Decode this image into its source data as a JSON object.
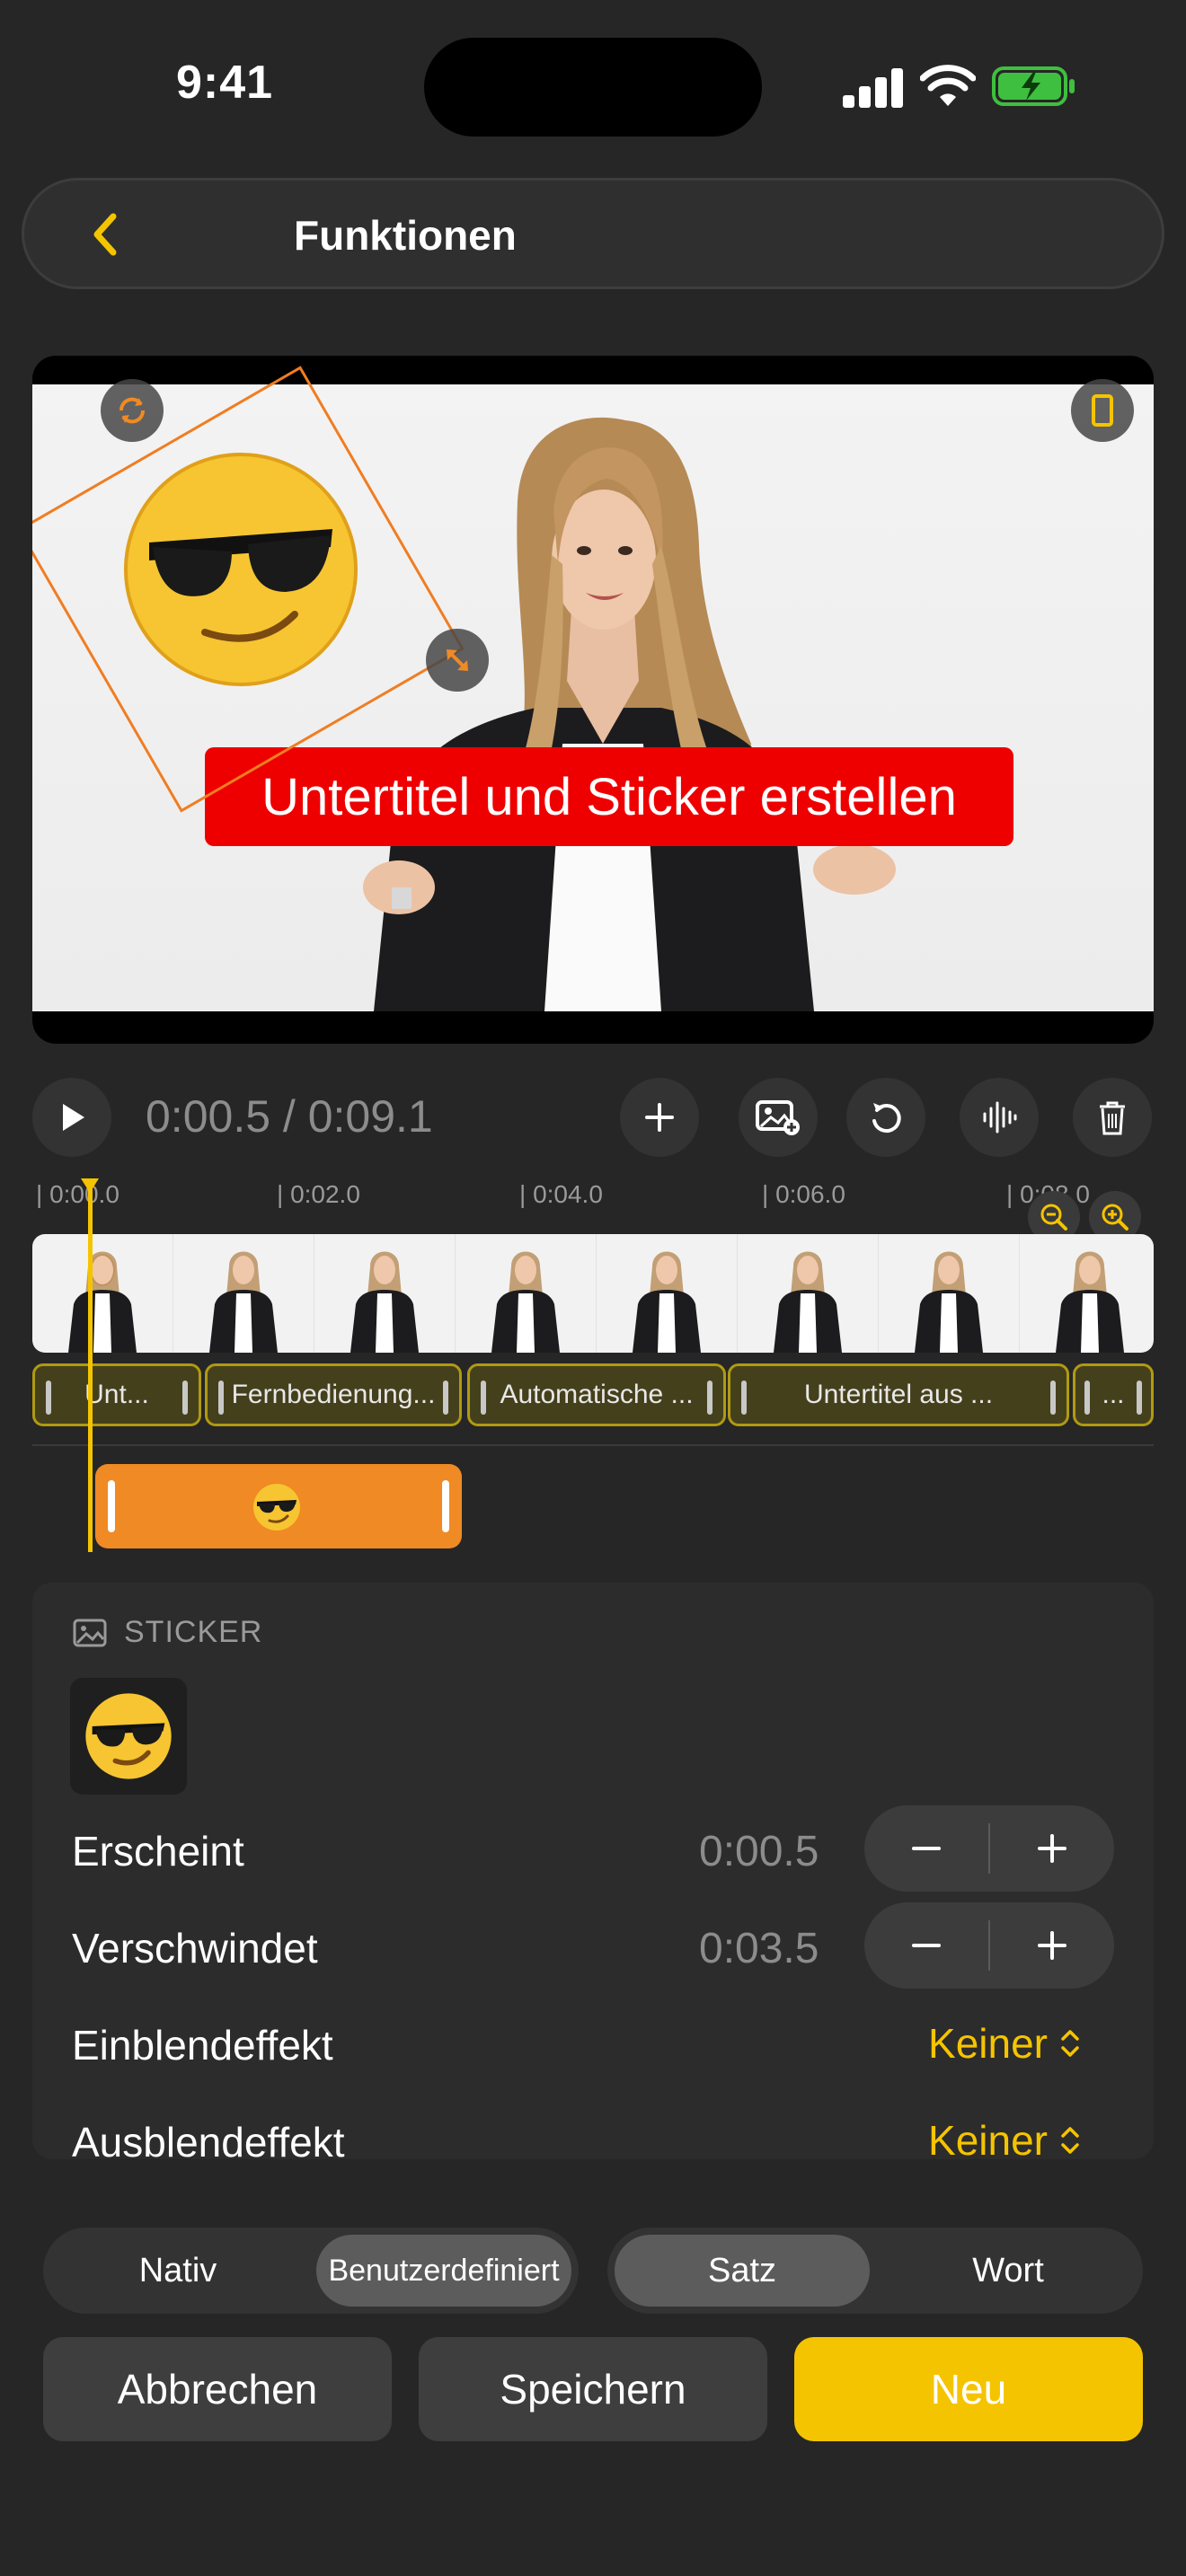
{
  "status_bar": {
    "time": "9:41"
  },
  "nav": {
    "title": "Funktionen"
  },
  "video": {
    "caption": "Untertitel und Sticker erstellen",
    "sticker": "😎"
  },
  "playback": {
    "current": "0:00.5",
    "separator": " / ",
    "total": "0:09.1"
  },
  "timeline": {
    "ticks": [
      "0:00.0",
      "0:02.0",
      "0:04.0",
      "0:06.0",
      "0:08.0"
    ],
    "subtitle_clips": [
      "Unt...",
      "Fernbedienung...",
      "Automatische ...",
      "Untertitel aus ...",
      "..."
    ],
    "sticker_clip": "😎"
  },
  "panel": {
    "header": "STICKER",
    "sticker": "😎",
    "appear_label": "Erscheint",
    "appear_value": "0:00.5",
    "disappear_label": "Verschwindet",
    "disappear_value": "0:03.5",
    "fade_in_label": "Einblendeffekt",
    "fade_in_value": "Keiner",
    "fade_out_label": "Ausblendeffekt",
    "fade_out_value": "Keiner"
  },
  "mode_segment": {
    "options": [
      "Nativ",
      "Benutzerdefiniert"
    ],
    "selected": "Benutzerdefiniert"
  },
  "unit_segment": {
    "options": [
      "Satz",
      "Wort"
    ],
    "selected": "Satz"
  },
  "buttons": {
    "cancel": "Abbrechen",
    "save": "Speichern",
    "new": "Neu"
  },
  "colors": {
    "accent": "#f5c400",
    "sticker_track": "#f08a24",
    "caption_bg": "#ee0000",
    "background": "#262626"
  }
}
